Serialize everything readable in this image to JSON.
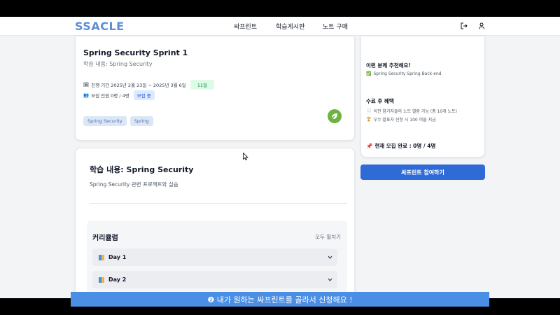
{
  "header": {
    "logo": "SSACLE",
    "nav": [
      "싸프린트",
      "학습게시판",
      "노트 구매"
    ]
  },
  "sprint": {
    "title": "Spring Security Sprint 1",
    "subtitle": "학습 내용: Spring Security",
    "period_label": "진행 기간 2025년 2월 23일 ~ 2025년 3월 6일",
    "days": "11일",
    "recruit_label": "모집 인원 0명 / 4명",
    "status": "모집 중",
    "tags": [
      "Spring Security",
      "Spring"
    ]
  },
  "detail": {
    "title": "학습 내용: Spring Security",
    "desc": "Spring Security 관련 프로젝트와 실습"
  },
  "curriculum": {
    "title": "커리큘럼",
    "expand_label": "모두 펼치기",
    "days": [
      "Day 1",
      "Day 2"
    ]
  },
  "side": {
    "recommend_title": "이런 분께 추천해요!",
    "recommend_item": "Spring Security Spring Back-end",
    "benefit_title": "수료 후 혜택",
    "benefit_1": "이전 참가자들의 노트 열람 가능 (총 10개 노트)",
    "benefit_2": "우수 발표자 선정 시 100 피클 지급",
    "recruit_done": "현재 모집 완료 : 0명 / 4명"
  },
  "join_button": "싸프린트 참여하기",
  "caption": "❷ 내가 원하는 싸프린트를 골라서 신청해요 !",
  "colors": {
    "brand": "#5b8fd6",
    "primary_button": "#2f6bd6",
    "caption_bg": "#4a8ee6",
    "days_pill": "#dcfce7",
    "status_pill": "#dbeafe"
  }
}
